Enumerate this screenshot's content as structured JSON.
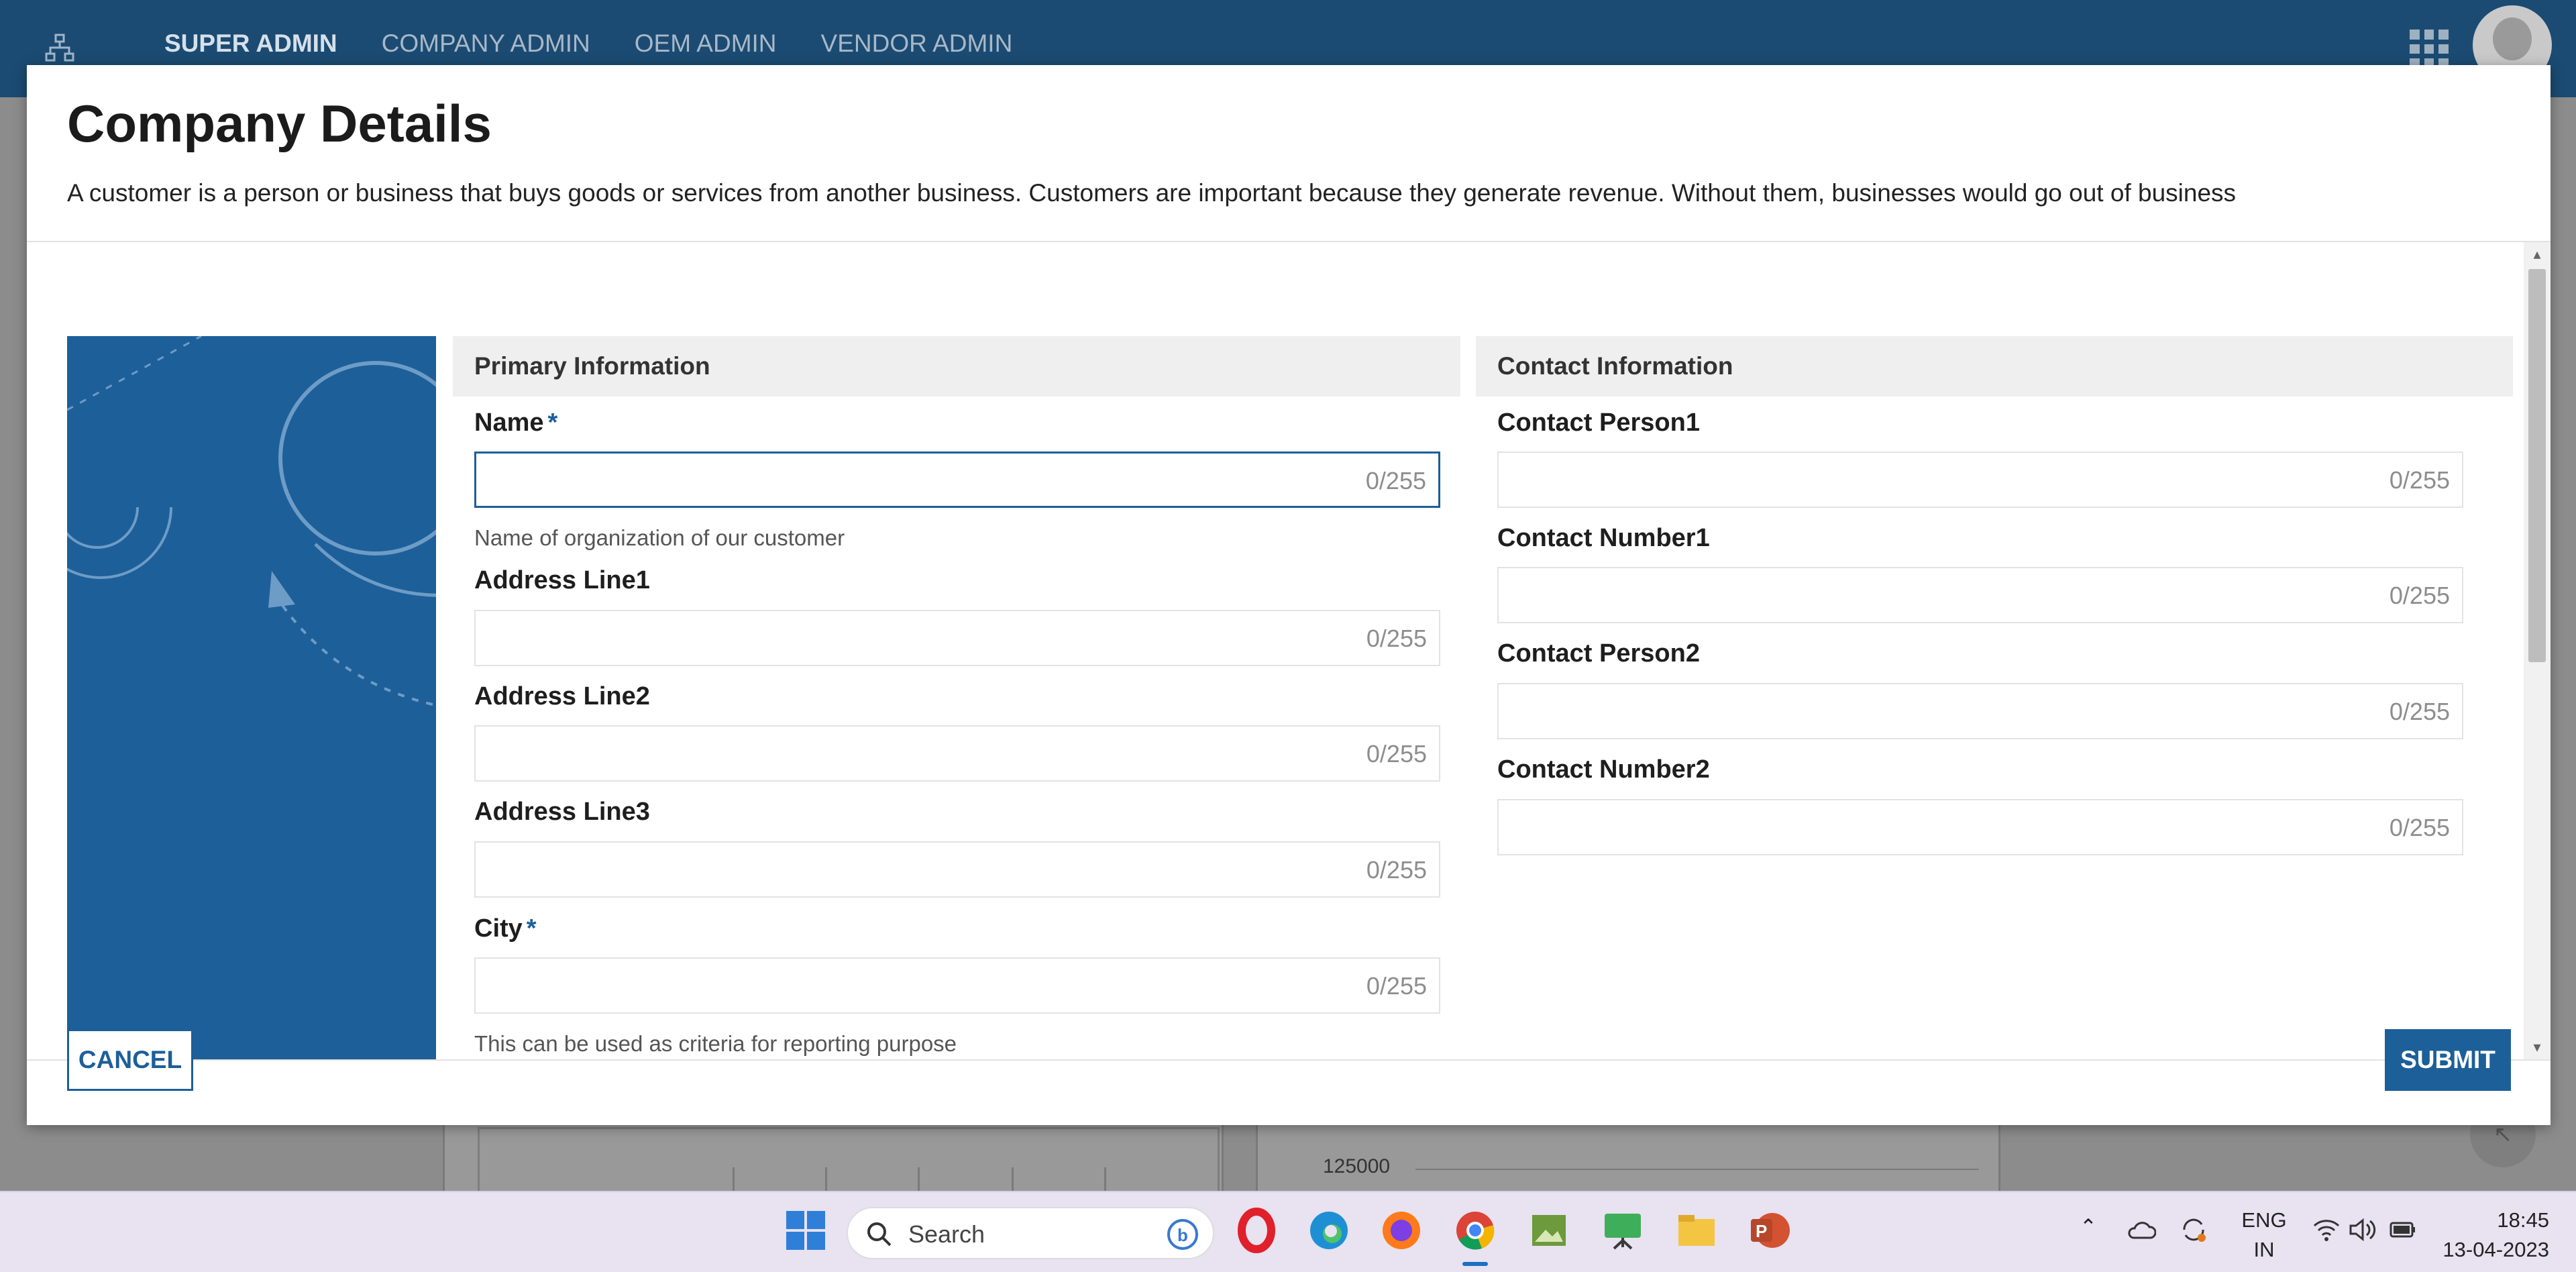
{
  "topbar": {
    "nav": [
      {
        "label": "SUPER ADMIN",
        "active": true
      },
      {
        "label": "COMPANY ADMIN",
        "active": false
      },
      {
        "label": "OEM ADMIN",
        "active": false
      },
      {
        "label": "VENDOR ADMIN",
        "active": false
      }
    ]
  },
  "background": {
    "axis_value": "125000"
  },
  "modal": {
    "title": "Company Details",
    "description": "A customer is a person or business that buys goods or services from another business. Customers are important because they generate revenue. Without them, businesses would go out of business",
    "primary": {
      "heading": "Primary Information",
      "fields": [
        {
          "label": "Name",
          "required": true,
          "value": "",
          "counter": "0/255",
          "helper": "Name of organization of our customer",
          "focused": true
        },
        {
          "label": "Address Line1",
          "required": false,
          "value": "",
          "counter": "0/255",
          "helper": ""
        },
        {
          "label": "Address Line2",
          "required": false,
          "value": "",
          "counter": "0/255",
          "helper": ""
        },
        {
          "label": "Address Line3",
          "required": false,
          "value": "",
          "counter": "0/255",
          "helper": ""
        },
        {
          "label": "City",
          "required": true,
          "value": "",
          "counter": "0/255",
          "helper": "This can be used as criteria for reporting purpose"
        }
      ]
    },
    "contact": {
      "heading": "Contact Information",
      "fields": [
        {
          "label": "Contact Person1",
          "value": "",
          "counter": "0/255"
        },
        {
          "label": "Contact Number1",
          "value": "",
          "counter": "0/255"
        },
        {
          "label": "Contact Person2",
          "value": "",
          "counter": "0/255"
        },
        {
          "label": "Contact Number2",
          "value": "",
          "counter": "0/255"
        }
      ]
    },
    "cancel_label": "CANCEL",
    "submit_label": "SUBMIT",
    "required_mark": "*"
  },
  "taskbar": {
    "search_label": "Search",
    "lang_line1": "ENG",
    "lang_line2": "IN",
    "time": "18:45",
    "date": "13-04-2023"
  },
  "colors": {
    "brand": "#1d5f99",
    "topbar": "#1b4b72"
  }
}
